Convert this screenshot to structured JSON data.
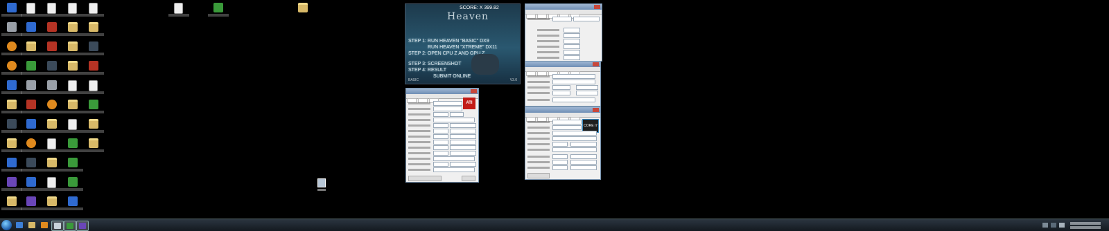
{
  "heaven": {
    "score_label": "SCORE: X 399.82",
    "logo": "Heaven",
    "steps": [
      "STEP 1: RUN HEAVEN \"BASIC\" DX9",
      "RUN HEAVEN \"XTREME\" DX11",
      "STEP 2: OPEN CPU Z  AND  GPU Z",
      "STEP 3: SCREENSHOT",
      "STEP 4: RESULT",
      "SUBMIT ONLINE"
    ],
    "version": "V3.0",
    "footer_left": "BASIC"
  },
  "gpuz": {
    "logo": "ATI"
  },
  "cpuz": {
    "logo": "CORE i7"
  },
  "colors": {
    "desktop": "#000000",
    "taskbar": "#1b232b",
    "ati_red": "#c21b17"
  }
}
